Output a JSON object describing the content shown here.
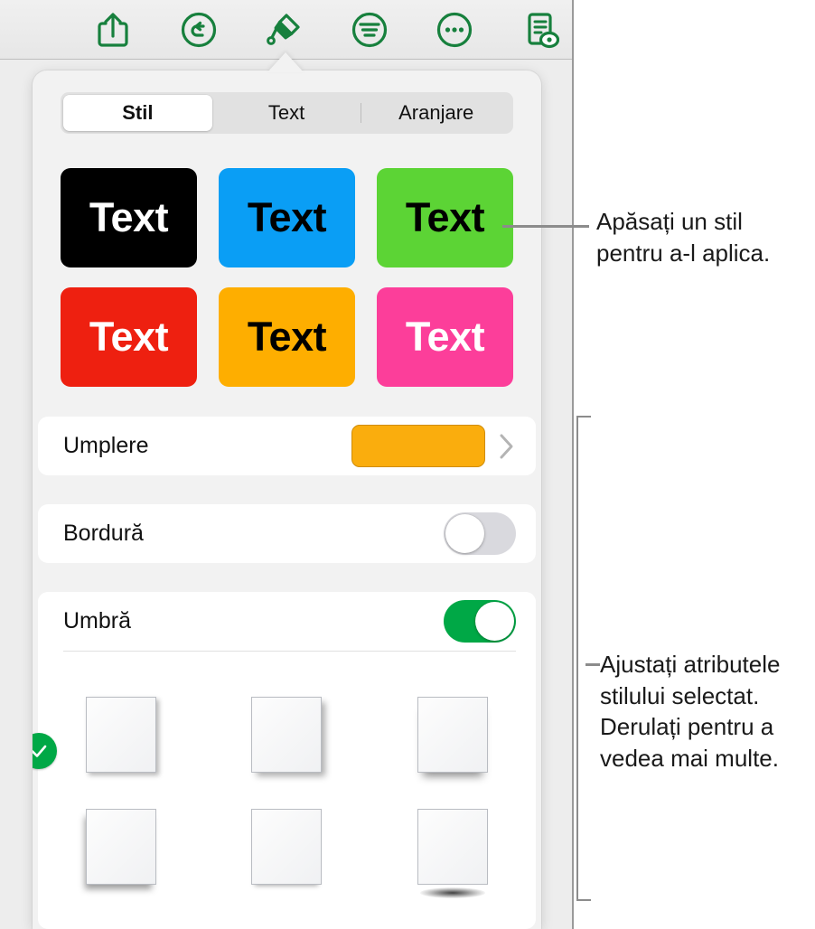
{
  "toolbar": {
    "buttons": [
      {
        "name": "share-icon",
        "label": "Partajare"
      },
      {
        "name": "undo-icon",
        "label": "Anulare"
      },
      {
        "name": "format-brush-icon",
        "label": "Format"
      },
      {
        "name": "insert-icon",
        "label": "Inserare"
      },
      {
        "name": "more-icon",
        "label": "Mai multe"
      },
      {
        "name": "document-preview-icon",
        "label": "Document"
      }
    ]
  },
  "popover": {
    "tabs": [
      {
        "label": "Stil",
        "active": true
      },
      {
        "label": "Text",
        "active": false
      },
      {
        "label": "Aranjare",
        "active": false
      }
    ],
    "style_swatches": [
      {
        "label": "Text",
        "bg": "#000000",
        "fg": "#ffffff"
      },
      {
        "label": "Text",
        "bg": "#0a9ef5",
        "fg": "#000000"
      },
      {
        "label": "Text",
        "bg": "#5cd435",
        "fg": "#000000"
      },
      {
        "label": "Text",
        "bg": "#ee2010",
        "fg": "#ffffff"
      },
      {
        "label": "Text",
        "bg": "#feae00",
        "fg": "#000000"
      },
      {
        "label": "Text",
        "bg": "#fc3e9a",
        "fg": "#ffffff"
      }
    ],
    "fill_row": {
      "label": "Umplere",
      "swatch_color": "#faad0d",
      "chevron": "chevron-right-icon"
    },
    "border_row": {
      "label": "Bordură",
      "toggle_state": "off"
    },
    "shadow_row": {
      "label": "Umbră",
      "toggle_state": "on",
      "toggle_on_color": "#00a846"
    },
    "shadow_options": [
      {
        "name": "shadow-option-1",
        "selected": true
      },
      {
        "name": "shadow-option-2",
        "selected": false
      },
      {
        "name": "shadow-option-3",
        "selected": false
      },
      {
        "name": "shadow-option-4",
        "selected": false
      },
      {
        "name": "shadow-option-5",
        "selected": false
      },
      {
        "name": "shadow-option-6",
        "selected": false
      }
    ],
    "selected_check_color": "#00a846"
  },
  "annotations": {
    "style_callout": "Apăsați un stil\npentru a-l aplica.",
    "attributes_callout": "Ajustați atributele\nstilului selectat.\nDerulați pentru a\nvedea mai multe."
  }
}
